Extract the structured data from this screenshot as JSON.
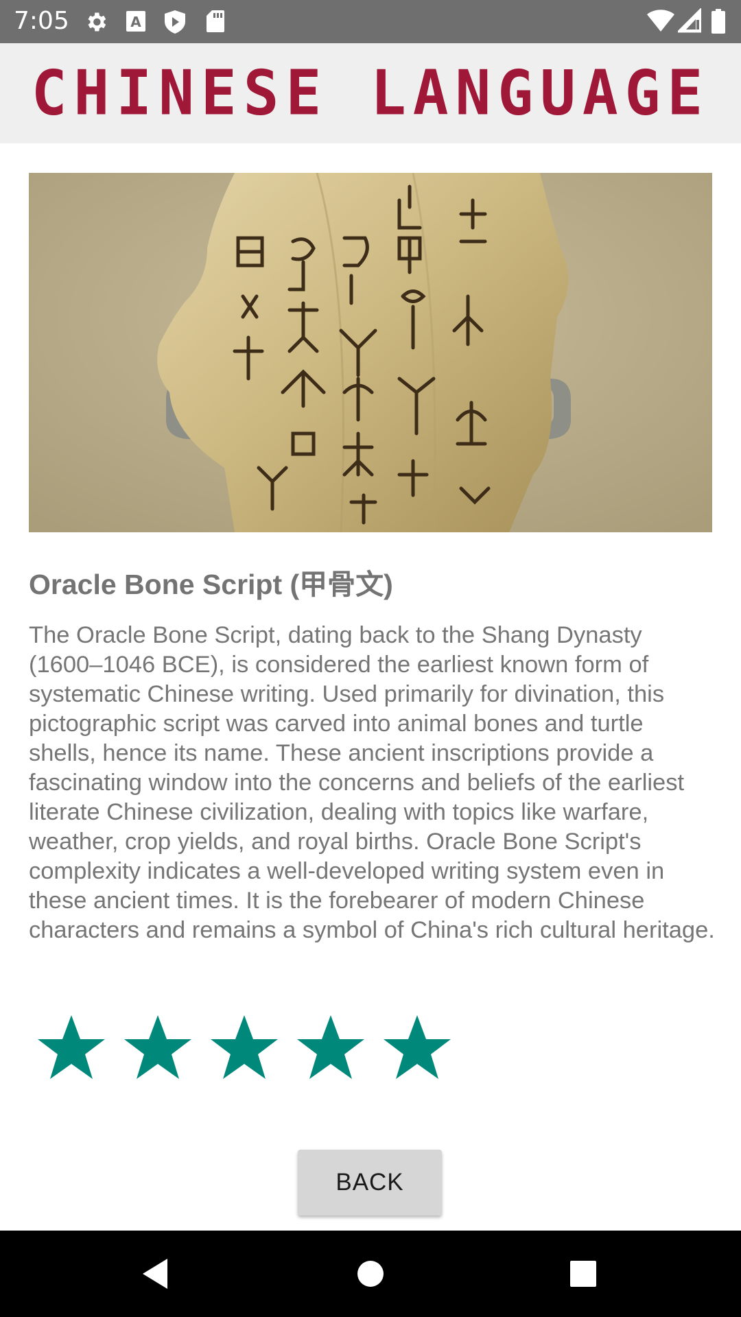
{
  "status_bar": {
    "time": "7:05",
    "left_icons": [
      "gear-icon",
      "font-a-icon",
      "shield-play-icon",
      "sd-card-icon"
    ],
    "right_icons": [
      "wifi-icon",
      "cell-signal-icon",
      "battery-icon"
    ]
  },
  "app_bar": {
    "title": "CHINESE LANGUAGE",
    "title_color": "#a01838"
  },
  "content": {
    "image_subject": "oracle-bone-fragment",
    "heading": "Oracle Bone Script (甲骨文)",
    "description": "The Oracle Bone Script, dating back to the Shang Dynasty (1600–1046 BCE), is considered the earliest known form of systematic Chinese writing. Used primarily for divination, this pictographic script was carved into animal bones and turtle shells, hence its name. These ancient inscriptions provide a fascinating window into the concerns and beliefs of the earliest literate Chinese civilization, dealing with topics like warfare, weather, crop yields, and royal births. Oracle Bone Script's complexity indicates a well-developed writing system even in these ancient times. It is the forebearer of modern Chinese characters and remains a symbol of China's rich cultural heritage.",
    "rating": {
      "value": 5,
      "max": 5,
      "color": "#00897b"
    },
    "back_label": "BACK"
  },
  "nav_bar": {
    "buttons": [
      "back-triangle-icon",
      "home-circle-icon",
      "recents-square-icon"
    ]
  }
}
